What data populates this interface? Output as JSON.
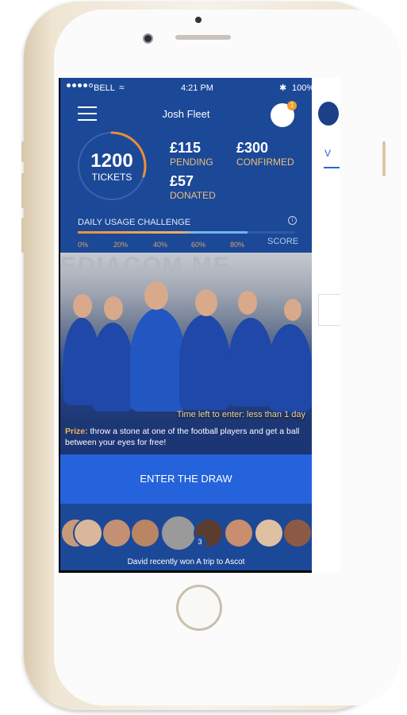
{
  "status": {
    "carrier": "BELL",
    "time": "4:21 PM",
    "battery": "100%",
    "wifi_icon": "wifi-icon",
    "bluetooth_icon": "bluetooth-icon"
  },
  "header": {
    "username": "Josh Fleet",
    "notification_count": "1"
  },
  "tickets": {
    "count": "1200",
    "label": "TICKETS",
    "ring_progress": 0.3
  },
  "stats": [
    {
      "value": "£115",
      "label": "PENDING"
    },
    {
      "value": "£300",
      "label": "CONFIRMED"
    },
    {
      "value": "£57",
      "label": "DONATED"
    }
  ],
  "challenge": {
    "title": "DAILY USAGE CHALLENGE",
    "ticks": [
      "0%",
      "20%",
      "40%",
      "60%",
      "80%"
    ],
    "score_label": "SCORE",
    "progress": 0.78
  },
  "promo": {
    "banner_text": "EDIACOM ME",
    "time_left": "Time left to enter: less than 1 day",
    "prize_label": "Prize:",
    "prize_text": "throw a stone at one of the football players and get a ball between your eyes for free!"
  },
  "cta": {
    "label": "ENTER THE DRAW"
  },
  "winners": {
    "text": "David recently won A trip to Ascot",
    "badge": "3"
  },
  "colors": {
    "app_bg": "#1c4898",
    "accent_orange": "#e8903a",
    "button_blue": "#2563dc",
    "accent_light_blue": "#6fb6ee"
  },
  "right_panel": {
    "tab_label": "V"
  }
}
